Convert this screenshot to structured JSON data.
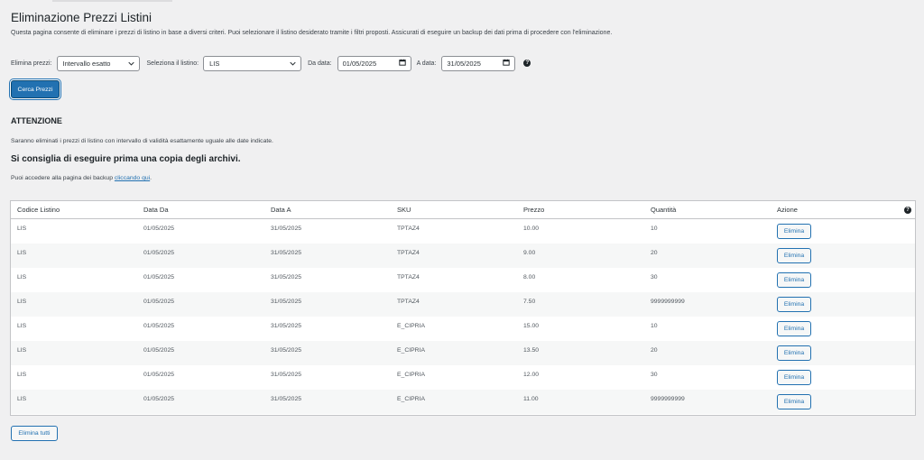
{
  "page": {
    "title": "Eliminazione Prezzi Listini",
    "description": "Questa pagina consente di eliminare i prezzi di listino in base a diversi criteri. Puoi selezionare il listino desiderato tramite i filtri proposti. Assicurati di eseguire un backup dei dati prima di procedere con l'eliminazione."
  },
  "filters": {
    "mode_label": "Elimina prezzi:",
    "mode_value": "Intervallo esatto",
    "list_label": "Seleziona il listino:",
    "list_value": "LIS",
    "from_label": "Da data:",
    "from_value": "01/05/2025",
    "to_label": "A data:",
    "to_value": "31/05/2025",
    "search_button": "Cerca Prezzi"
  },
  "notice": {
    "heading": "ATTENZIONE",
    "text": "Saranno eliminati i prezzi di listino con intervallo di validità esattamente uguale alle date indicate.",
    "advice": "Si consiglia di eseguire prima una copia degli archivi.",
    "backup_prefix": "Puoi accedere alla pagina dei backup ",
    "backup_link": "cliccando qui",
    "backup_suffix": "."
  },
  "table": {
    "columns": [
      "Codice Listino",
      "Data Da",
      "Data A",
      "SKU",
      "Prezzo",
      "Quantità",
      "Azione"
    ],
    "action_label": "Elimina",
    "rows": [
      [
        "LIS",
        "01/05/2025",
        "31/05/2025",
        "TPTAZ4",
        "10.00",
        "10"
      ],
      [
        "LIS",
        "01/05/2025",
        "31/05/2025",
        "TPTAZ4",
        "9.00",
        "20"
      ],
      [
        "LIS",
        "01/05/2025",
        "31/05/2025",
        "TPTAZ4",
        "8.00",
        "30"
      ],
      [
        "LIS",
        "01/05/2025",
        "31/05/2025",
        "TPTAZ4",
        "7.50",
        "9999999999"
      ],
      [
        "LIS",
        "01/05/2025",
        "31/05/2025",
        "E_CIPRIA",
        "15.00",
        "10"
      ],
      [
        "LIS",
        "01/05/2025",
        "31/05/2025",
        "E_CIPRIA",
        "13.50",
        "20"
      ],
      [
        "LIS",
        "01/05/2025",
        "31/05/2025",
        "E_CIPRIA",
        "12.00",
        "30"
      ],
      [
        "LIS",
        "01/05/2025",
        "31/05/2025",
        "E_CIPRIA",
        "11.00",
        "9999999999"
      ]
    ]
  },
  "footer": {
    "delete_all_button": "Elimina tutti"
  },
  "icons": {
    "help": "help-icon",
    "calendar": "calendar-icon",
    "dropdown": "chevron-down-icon"
  },
  "colors": {
    "accent": "#2271b1",
    "background": "#f0f0f1",
    "row_alt": "#f6f7f7"
  }
}
